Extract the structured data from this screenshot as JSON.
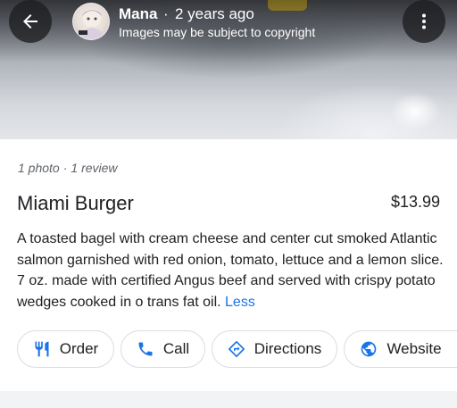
{
  "header": {
    "uploader": "Mana",
    "separator": "·",
    "time_ago": "2 years ago",
    "copyright_note": "Images may be subject to copyright",
    "back_icon": "arrow-left-icon",
    "more_icon": "more-vertical-icon"
  },
  "summary": {
    "photos": "1 photo",
    "separator": "·",
    "reviews": "1 review"
  },
  "item": {
    "name": "Miami Burger",
    "price": "$13.99",
    "description": "A toasted bagel with cream cheese and center cut smoked Atlantic salmon garnished with red onion, tomato, lettuce and a lemon slice. 7 oz. made with certified Angus beef and served with crispy potato wedges cooked in o trans fat oil.",
    "less_label": "Less"
  },
  "actions": [
    {
      "label": "Order",
      "icon": "fork-knife-icon"
    },
    {
      "label": "Call",
      "icon": "phone-icon"
    },
    {
      "label": "Directions",
      "icon": "directions-icon"
    },
    {
      "label": "Website",
      "icon": "globe-icon"
    }
  ],
  "colors": {
    "accent": "#1a73e8",
    "text_primary": "#202124",
    "text_secondary": "#5f6368",
    "chip_border": "#dadce0"
  }
}
